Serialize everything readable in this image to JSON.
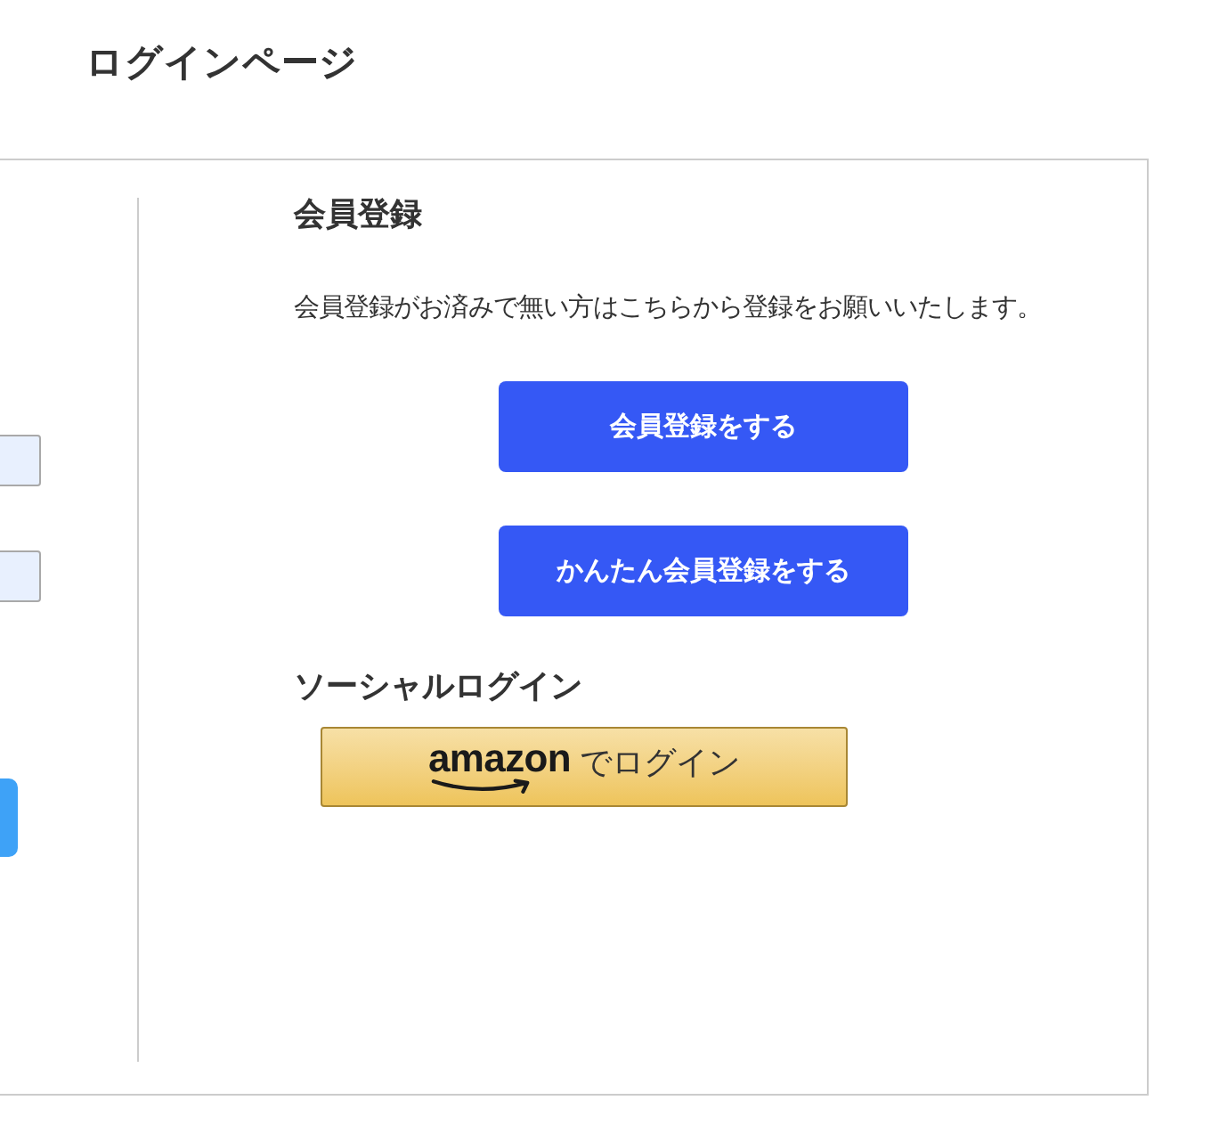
{
  "page": {
    "title": "ログインページ"
  },
  "login_form": {
    "fields": [
      {
        "autofilled": true
      },
      {
        "autofilled": true
      }
    ]
  },
  "registration": {
    "heading": "会員登録",
    "description": "会員登録がお済みで無い方はこちらから登録をお願いいたします。",
    "buttons": [
      {
        "label": "会員登録をする"
      },
      {
        "label": "かんたん会員登録をする"
      }
    ]
  },
  "social_login": {
    "heading": "ソーシャルログイン",
    "buttons": [
      {
        "kind": "amazon",
        "logo_text": "amazon",
        "label": "でログイン"
      }
    ]
  }
}
